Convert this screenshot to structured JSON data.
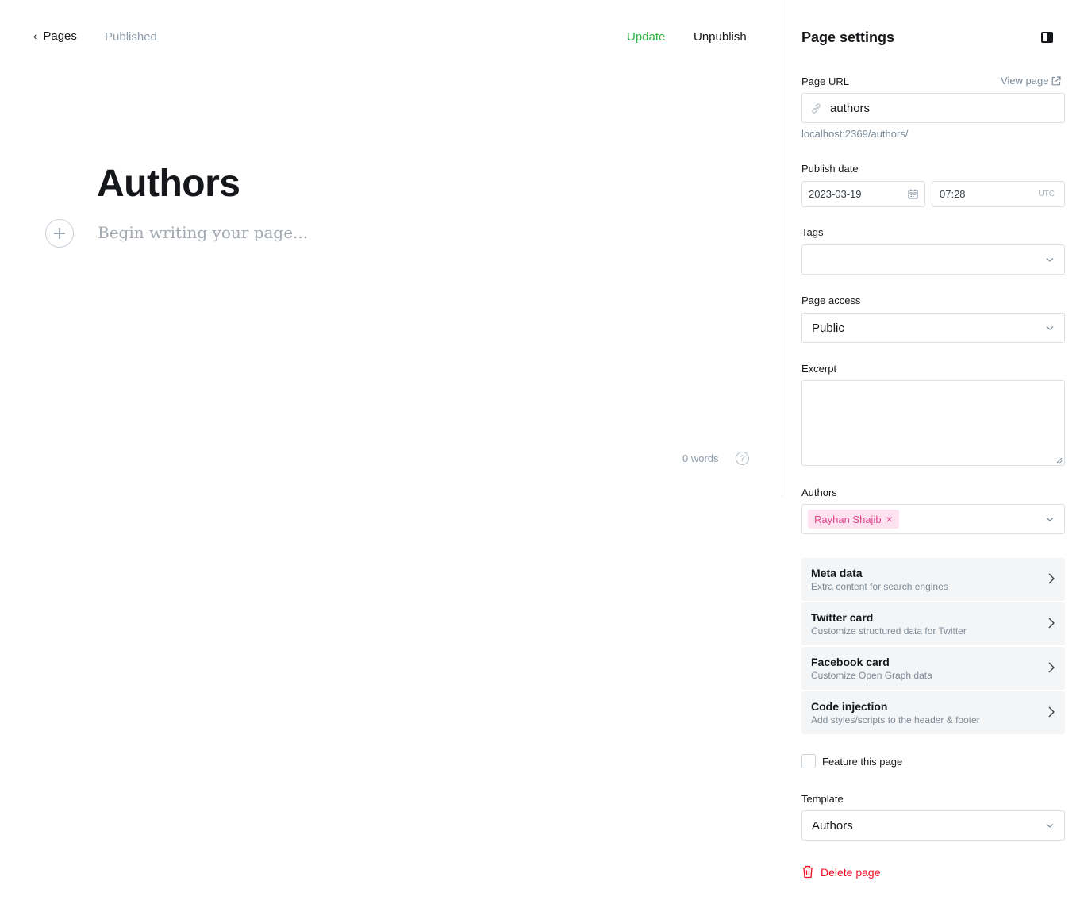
{
  "header": {
    "back_label": "Pages",
    "status": "Published",
    "update_label": "Update",
    "unpublish_label": "Unpublish"
  },
  "editor": {
    "title": "Authors",
    "body_placeholder": "Begin writing your page...",
    "word_count": "0 words",
    "help_glyph": "?"
  },
  "settings": {
    "title": "Page settings",
    "url": {
      "label": "Page URL",
      "view_link": "View page",
      "value": "authors",
      "hint": "localhost:2369/authors/"
    },
    "publish_date": {
      "label": "Publish date",
      "date": "2023-03-19",
      "time": "07:28",
      "timezone": "UTC"
    },
    "tags": {
      "label": "Tags",
      "value": ""
    },
    "access": {
      "label": "Page access",
      "value": "Public"
    },
    "excerpt": {
      "label": "Excerpt",
      "value": ""
    },
    "authors": {
      "label": "Authors",
      "tokens": [
        "Rayhan Shajib"
      ]
    },
    "nav": [
      {
        "title": "Meta data",
        "subtitle": "Extra content for search engines"
      },
      {
        "title": "Twitter card",
        "subtitle": "Customize structured data for Twitter"
      },
      {
        "title": "Facebook card",
        "subtitle": "Customize Open Graph data"
      },
      {
        "title": "Code injection",
        "subtitle": "Add styles/scripts to the header & footer"
      }
    ],
    "feature_label": "Feature this page",
    "template": {
      "label": "Template",
      "value": "Authors"
    },
    "delete_label": "Delete page"
  },
  "colors": {
    "update": "#2fb344",
    "delete": "#f50b23",
    "author_token_bg": "#fde3ef",
    "author_token_text": "#e1468f"
  }
}
